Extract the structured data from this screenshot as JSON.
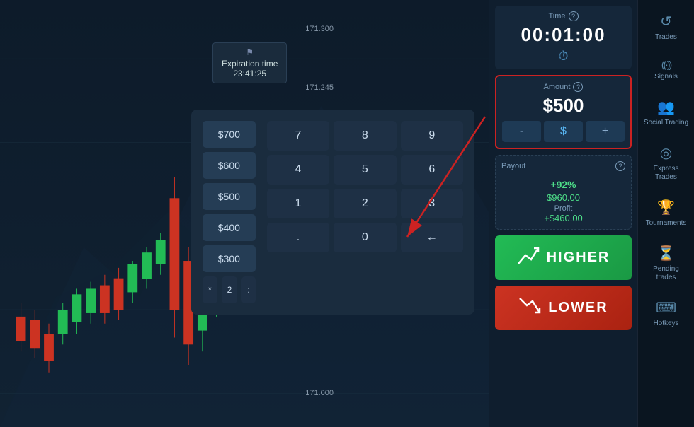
{
  "chart": {
    "price_top": "171.300",
    "price_mid": "171.245",
    "price_bot": "171.000",
    "expiration_label": "Expiration time",
    "expiration_time": "23:41:25"
  },
  "keypad": {
    "amounts": [
      "$700",
      "$600",
      "$500",
      "$400",
      "$300"
    ],
    "numbers": [
      "7",
      "8",
      "9",
      "4",
      "5",
      "6",
      "1",
      "2",
      "3"
    ],
    "special_star": "*",
    "special_two": "2",
    "special_colon": ":",
    "special_dot": ".",
    "special_zero": "0",
    "special_back": "←"
  },
  "time_section": {
    "label": "Time",
    "value": "00:01:00"
  },
  "amount_section": {
    "label": "Amount",
    "value": "$500",
    "btn_minus": "-",
    "btn_dollar": "$",
    "btn_plus": "+"
  },
  "payout_section": {
    "label": "Payout",
    "percent": "+92",
    "percent_sign": "%",
    "amount": "$960.00",
    "profit_label": "Profit",
    "profit_amount": "+$460.00"
  },
  "buttons": {
    "higher": "HIGHER",
    "lower": "LOWER"
  },
  "sidebar": {
    "items": [
      {
        "id": "trades",
        "icon": "↺",
        "label": "Trades"
      },
      {
        "id": "signals",
        "icon": "((·))",
        "label": "Signals"
      },
      {
        "id": "social-trading",
        "icon": "👥",
        "label": "Social Trading"
      },
      {
        "id": "express-trades",
        "icon": "◎",
        "label": "Express Trades"
      },
      {
        "id": "tournaments",
        "icon": "🏆",
        "label": "Tournaments"
      },
      {
        "id": "pending-trades",
        "icon": "⏳",
        "label": "Pending trades"
      },
      {
        "id": "hotkeys",
        "icon": "⌨",
        "label": "Hotkeys"
      }
    ]
  }
}
